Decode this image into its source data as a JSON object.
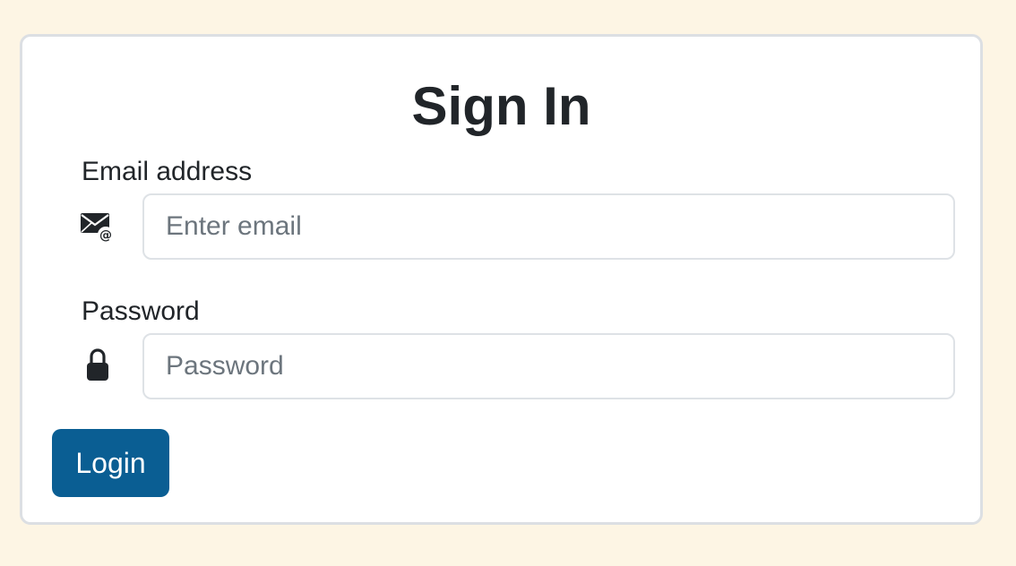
{
  "form": {
    "title": "Sign In",
    "email": {
      "label": "Email address",
      "placeholder": "Enter email",
      "value": "",
      "icon": "envelope-at-icon"
    },
    "password": {
      "label": "Password",
      "placeholder": "Password",
      "value": "",
      "icon": "lock-icon"
    },
    "submit_label": "Login"
  },
  "colors": {
    "page_background": "#fdf5e4",
    "card_background": "#ffffff",
    "card_border": "#dcdfe3",
    "primary_button": "#0a5e93",
    "text": "#212529"
  }
}
